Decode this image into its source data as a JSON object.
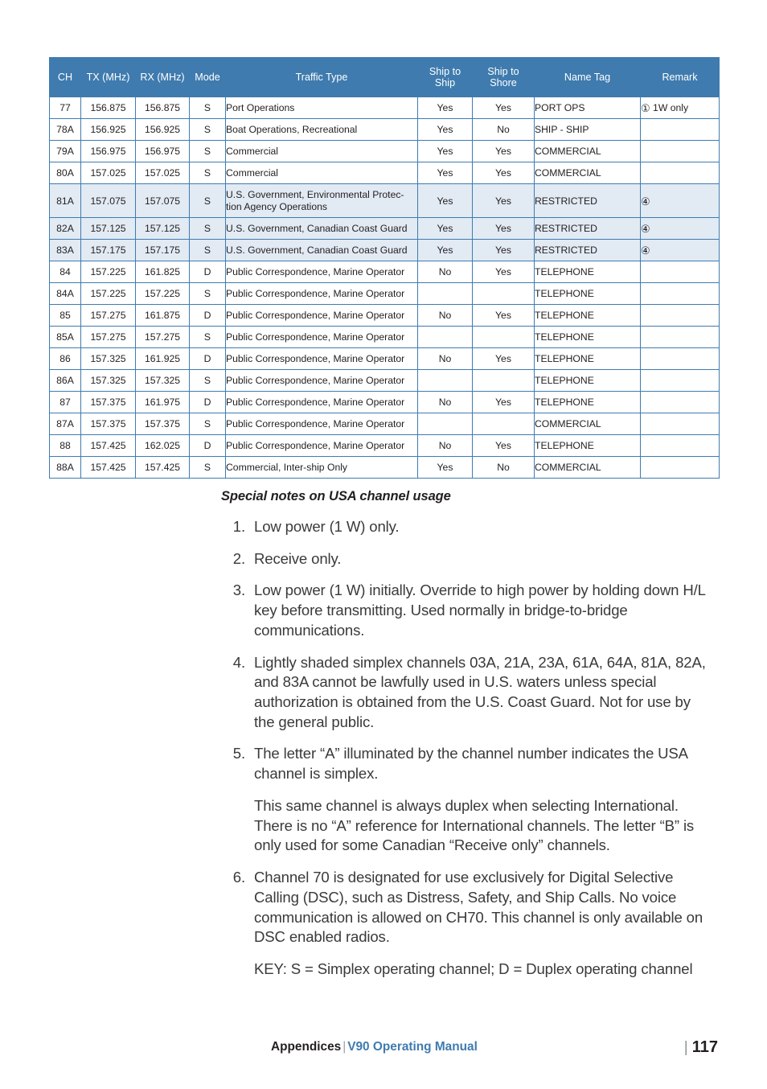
{
  "table": {
    "columns": [
      "CH",
      "TX (MHz)",
      "RX (MHz)",
      "Mode",
      "Traffic Type",
      "Ship to Ship",
      "Ship to Shore",
      "Name Tag",
      "Remark"
    ],
    "column_headers": {
      "ch": "CH",
      "tx": "TX (MHz)",
      "rx": "RX (MHz)",
      "mode": "Mode",
      "traffic": "Traffic Type",
      "ship_to_ship_line1": "Ship to",
      "ship_to_ship_line2": "Ship",
      "ship_to_shore_line1": "Ship to",
      "ship_to_shore_line2": "Shore",
      "name_tag": "Name Tag",
      "remark": "Remark"
    },
    "header_bg": "#3f7bae",
    "shaded_row_bg": "#e2eaf3",
    "border_color": "#3f7bb0",
    "rows": [
      {
        "ch": "77",
        "tx": "156.875",
        "rx": "156.875",
        "mode": "S",
        "traffic": "Port Operations",
        "s2s": "Yes",
        "s2sh": "Yes",
        "name": "PORT OPS",
        "remark": "① 1W only",
        "shaded": false
      },
      {
        "ch": "78A",
        "tx": "156.925",
        "rx": "156.925",
        "mode": "S",
        "traffic": "Boat Operations, Recreational",
        "s2s": "Yes",
        "s2sh": "No",
        "name": "SHIP - SHIP",
        "remark": "",
        "shaded": false
      },
      {
        "ch": "79A",
        "tx": "156.975",
        "rx": "156.975",
        "mode": "S",
        "traffic": "Commercial",
        "s2s": "Yes",
        "s2sh": "Yes",
        "name": "COMMERCIAL",
        "remark": "",
        "shaded": false
      },
      {
        "ch": "80A",
        "tx": "157.025",
        "rx": "157.025",
        "mode": "S",
        "traffic": "Commercial",
        "s2s": "Yes",
        "s2sh": "Yes",
        "name": "COMMERCIAL",
        "remark": "",
        "shaded": false
      },
      {
        "ch": "81A",
        "tx": "157.075",
        "rx": "157.075",
        "mode": "S",
        "traffic": "U.S. Government, Environmental Protec-tion Agency Operations",
        "s2s": "Yes",
        "s2sh": "Yes",
        "name": "RESTRICTED",
        "remark": "④",
        "shaded": true,
        "tall": true
      },
      {
        "ch": "82A",
        "tx": "157.125",
        "rx": "157.125",
        "mode": "S",
        "traffic": "U.S. Government, Canadian Coast Guard",
        "s2s": "Yes",
        "s2sh": "Yes",
        "name": "RESTRICTED",
        "remark": "④",
        "shaded": true
      },
      {
        "ch": "83A",
        "tx": "157.175",
        "rx": "157.175",
        "mode": "S",
        "traffic": "U.S. Government, Canadian Coast Guard",
        "s2s": "Yes",
        "s2sh": "Yes",
        "name": "RESTRICTED",
        "remark": "④",
        "shaded": true
      },
      {
        "ch": "84",
        "tx": "157.225",
        "rx": "161.825",
        "mode": "D",
        "traffic": "Public Correspondence, Marine Operator",
        "s2s": "No",
        "s2sh": "Yes",
        "name": "TELEPHONE",
        "remark": "",
        "shaded": false
      },
      {
        "ch": "84A",
        "tx": "157.225",
        "rx": "157.225",
        "mode": "S",
        "traffic": "Public Correspondence, Marine Operator",
        "s2s": "",
        "s2sh": "",
        "name": "TELEPHONE",
        "remark": "",
        "shaded": false
      },
      {
        "ch": "85",
        "tx": "157.275",
        "rx": "161.875",
        "mode": "D",
        "traffic": "Public Correspondence, Marine Operator",
        "s2s": "No",
        "s2sh": "Yes",
        "name": "TELEPHONE",
        "remark": "",
        "shaded": false
      },
      {
        "ch": "85A",
        "tx": "157.275",
        "rx": "157.275",
        "mode": "S",
        "traffic": "Public Correspondence, Marine Operator",
        "s2s": "",
        "s2sh": "",
        "name": "TELEPHONE",
        "remark": "",
        "shaded": false
      },
      {
        "ch": "86",
        "tx": "157.325",
        "rx": "161.925",
        "mode": "D",
        "traffic": "Public Correspondence, Marine Operator",
        "s2s": "No",
        "s2sh": "Yes",
        "name": "TELEPHONE",
        "remark": "",
        "shaded": false
      },
      {
        "ch": "86A",
        "tx": "157.325",
        "rx": "157.325",
        "mode": "S",
        "traffic": "Public Correspondence, Marine Operator",
        "s2s": "",
        "s2sh": "",
        "name": "TELEPHONE",
        "remark": "",
        "shaded": false
      },
      {
        "ch": "87",
        "tx": "157.375",
        "rx": "161.975",
        "mode": "D",
        "traffic": "Public Correspondence, Marine Operator",
        "s2s": "No",
        "s2sh": "Yes",
        "name": "TELEPHONE",
        "remark": "",
        "shaded": false
      },
      {
        "ch": "87A",
        "tx": "157.375",
        "rx": "157.375",
        "mode": "S",
        "traffic": "Public Correspondence, Marine Operator",
        "s2s": "",
        "s2sh": "",
        "name": "COMMERCIAL",
        "remark": "",
        "shaded": false
      },
      {
        "ch": "88",
        "tx": "157.425",
        "rx": "162.025",
        "mode": "D",
        "traffic": "Public Correspondence, Marine Operator",
        "s2s": "No",
        "s2sh": "Yes",
        "name": "TELEPHONE",
        "remark": "",
        "shaded": false
      },
      {
        "ch": "88A",
        "tx": "157.425",
        "rx": "157.425",
        "mode": "S",
        "traffic": "Commercial, Inter-ship Only",
        "s2s": "Yes",
        "s2sh": "No",
        "name": "COMMERCIAL",
        "remark": "",
        "shaded": false
      }
    ]
  },
  "notes": {
    "title": "Special notes on USA channel usage",
    "items": [
      {
        "num": "1.",
        "text": "Low power (1 W) only."
      },
      {
        "num": "2.",
        "text": "Receive only."
      },
      {
        "num": "3.",
        "text": "Low power (1 W) initially. Override to high power by holding down H/L key before transmitting. Used normally in bridge-to-bridge communications."
      },
      {
        "num": "4.",
        "text": "Lightly shaded simplex channels 03A, 21A, 23A, 61A, 64A, 81A, 82A, and 83A cannot be lawfully used in U.S. waters unless special authorization is obtained from the U.S. Coast Guard. Not for use by the general public."
      },
      {
        "num": "5.",
        "text": "The letter “A” illuminated by the channel number indicates the USA channel is simplex."
      },
      {
        "num": "6.",
        "text": "Channel 70 is designated for use exclusively for Digital Selective Calling (DSC), such as Distress, Safety, and Ship Calls. No voice communication is allowed on CH70. This channel is only available on DSC enabled radios."
      }
    ],
    "sub_after_5": "This same channel is always duplex when selecting International. There is no “A” reference for International channels. The letter “B” is only used for some Canadian “Receive only” channels.",
    "key_line": "KEY: S = Simplex operating channel; D = Duplex operating channel"
  },
  "footer": {
    "section": "Appendices",
    "separator": "|",
    "manual": "V90 Operating Manual",
    "page_bar": "|",
    "page_number": "117",
    "accent_color": "#3f7bae"
  }
}
